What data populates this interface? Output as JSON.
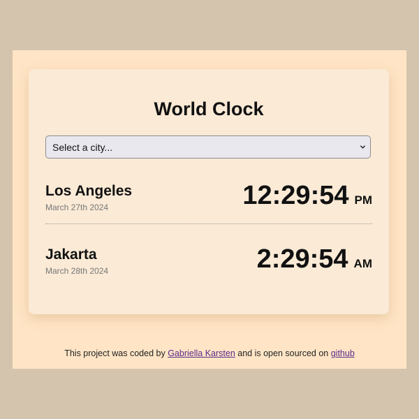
{
  "app": {
    "title": "World Clock"
  },
  "city_select": {
    "label": "Select a city..."
  },
  "cities": [
    {
      "name": "Los Angeles",
      "date": "March 27th 2024",
      "time": "12:29:54",
      "ampm": "PM"
    },
    {
      "name": "Jakarta",
      "date": "March 28th 2024",
      "time": "2:29:54",
      "ampm": "AM"
    }
  ],
  "footer": {
    "text_before": "This project was coded by",
    "author_link": "Gabriella Karsten",
    "text_middle": "and is open sourced on",
    "repo_link": "github"
  },
  "colors": {
    "outer_background": "#d5c4ad",
    "page_background": "#ffe5c6",
    "card_background": "#faead6",
    "link": "#5a2a8a"
  }
}
